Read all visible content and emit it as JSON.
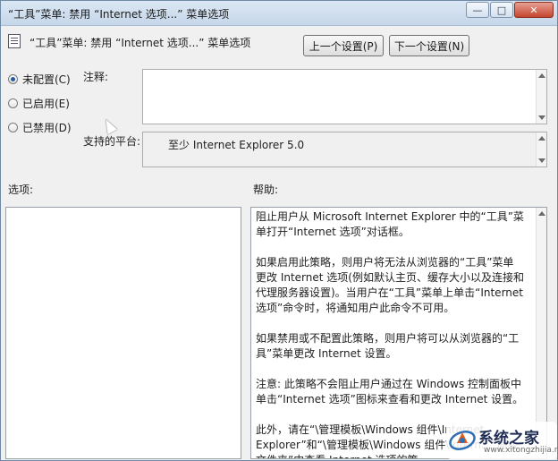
{
  "window": {
    "title": "“工具”菜单: 禁用 “Internet 选项...” 菜单选项",
    "minimize_label": "—",
    "maximize_label": "□",
    "close_label": "✕"
  },
  "header": {
    "policy_title": "“工具”菜单: 禁用 “Internet 选项...” 菜单选项",
    "prev_button": "上一个设置(P)",
    "next_button": "下一个设置(N)"
  },
  "state_options": [
    {
      "label": "未配置(C)",
      "checked": true
    },
    {
      "label": "已启用(E)",
      "checked": false
    },
    {
      "label": "已禁用(D)",
      "checked": false
    }
  ],
  "comment": {
    "label": "注释:",
    "value": ""
  },
  "platform": {
    "label": "支持的平台:",
    "value": "至少 Internet Explorer 5.0"
  },
  "options_label": "选项:",
  "help": {
    "label": "帮助:",
    "paragraphs": [
      "阻止用户从 Microsoft Internet Explorer 中的“工具”菜单打开“Internet 选项”对话框。",
      "如果启用此策略，则用户将无法从浏览器的“工具”菜单更改 Internet 选项(例如默认主页、缓存大小以及连接和代理服务器设置)。当用户在“工具”菜单上单击“Internet 选项”命令时，将通知用户此命令不可用。",
      "如果禁用或不配置此策略，则用户将可以从浏览器的“工具”菜单更改 Internet 设置。",
      "注意: 此策略不会阻止用户通过在 Windows 控制面板中单击“Internet 选项”图标来查看和更改 Internet 设置。",
      "此外，请在“\\管理模板\\Windows 组件\\Internet Explorer”和“\\管理模板\\Windows 组件\\Intern...”面板文件夹”中查看 Internet 选项的策..."
    ]
  },
  "watermark": {
    "name": "系统之家",
    "url": "www.xitongzhijia.net"
  },
  "colors": {
    "titlebar": "#c6d7ea",
    "window_bg": "#f0f0f0",
    "radio_dot": "#2a5a9a"
  }
}
